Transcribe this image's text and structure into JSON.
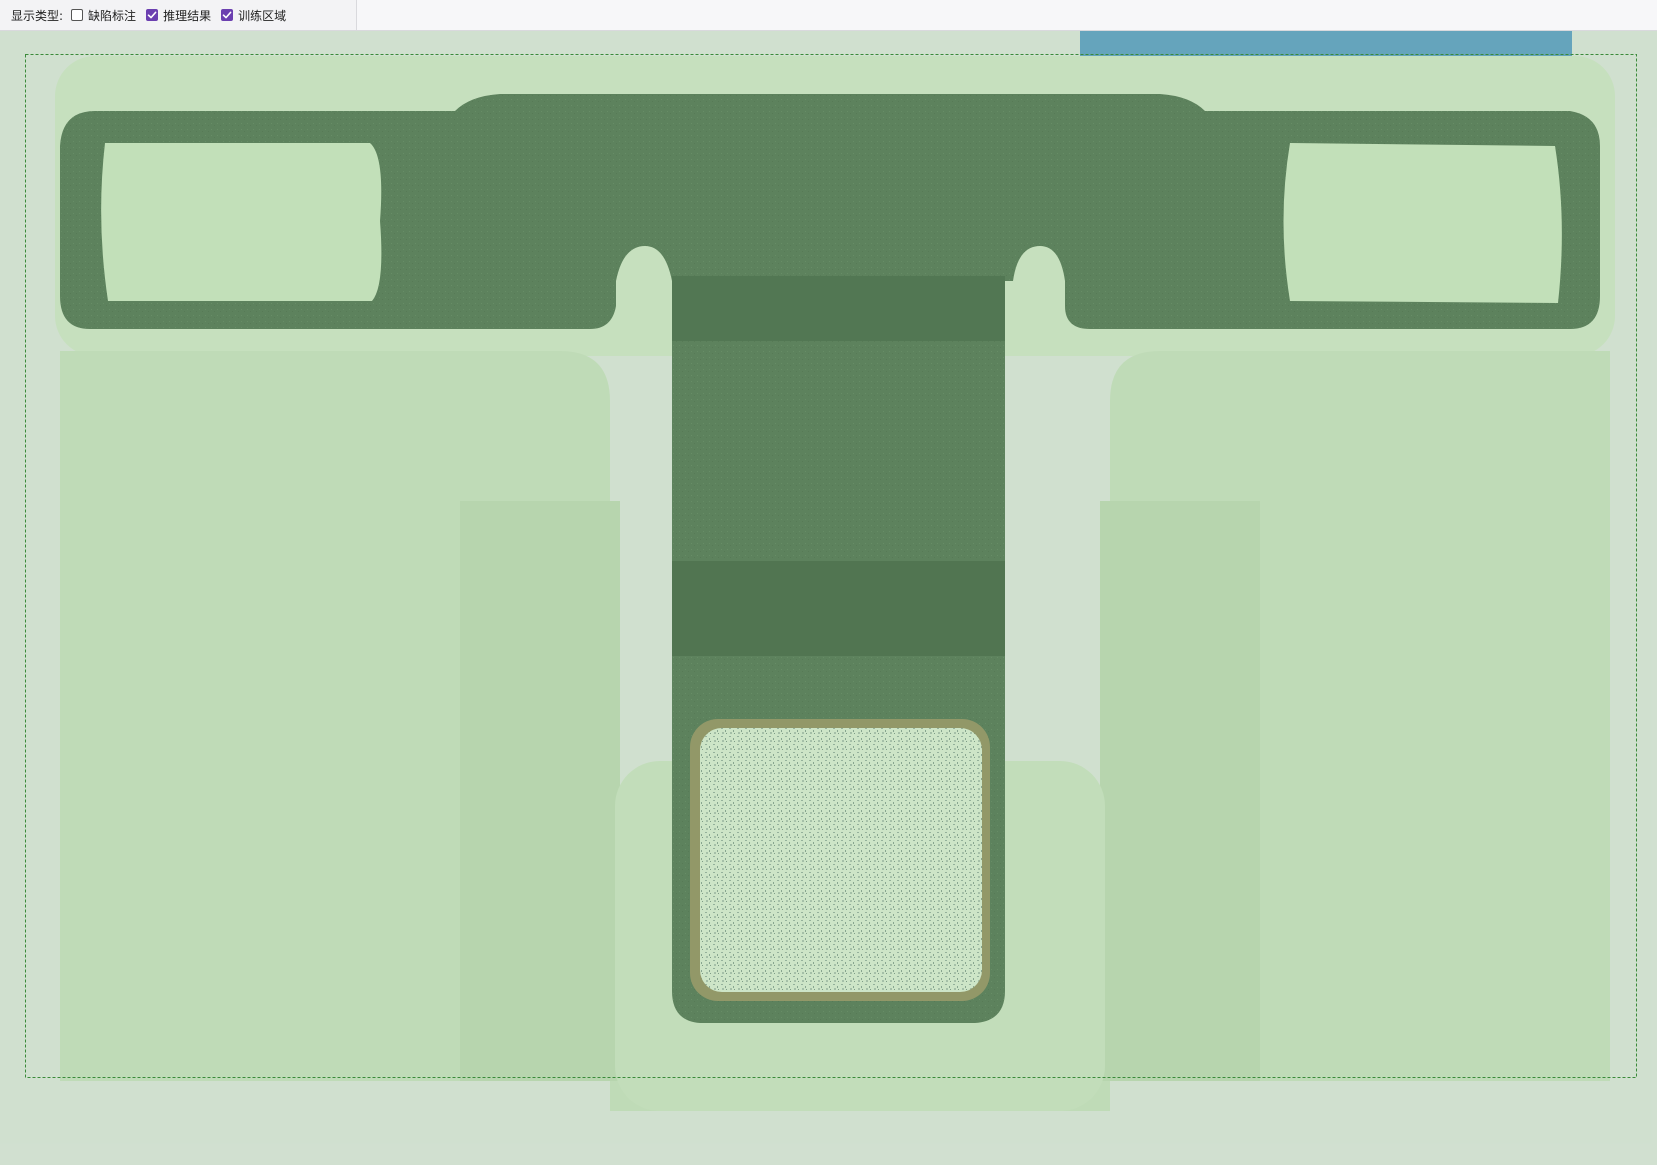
{
  "toolbar": {
    "display_type_label": "显示类型:",
    "checkboxes": [
      {
        "label": "缺陷标注",
        "checked": false
      },
      {
        "label": "推理结果",
        "checked": true
      },
      {
        "label": "训练区域",
        "checked": true
      }
    ]
  },
  "colors": {
    "overlay_green": "#b6d7b0",
    "part_dark": "#3f5e44",
    "pad_light": "#d6ead0",
    "tape_blue": "#4a8fd0",
    "checkbox_checked": "#6b3fb0",
    "training_region_border": "#3a8a3a"
  }
}
